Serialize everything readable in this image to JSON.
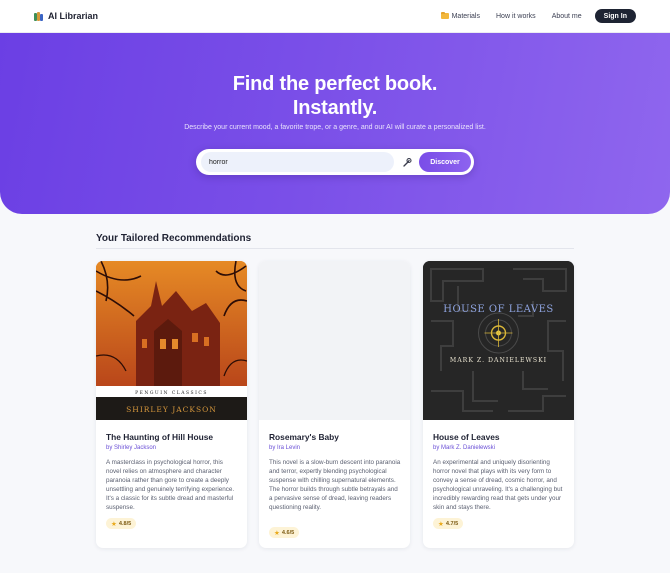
{
  "nav": {
    "brand": "AI Librarian",
    "links": [
      "Materials",
      "How it works",
      "About me"
    ],
    "signin": "Sign In"
  },
  "hero": {
    "title_line1": "Find the perfect book.",
    "title_line2": "Instantly.",
    "subtitle": "Describe your current mood, a favorite trope, or a genre, and our AI will curate a personalized list.",
    "search_value": "horror",
    "discover": "Discover"
  },
  "section": {
    "title": "Your Tailored Recommendations"
  },
  "books": [
    {
      "title": "The Haunting of Hill House",
      "author": "by Shirley Jackson",
      "description": "A masterclass in psychological horror, this novel relies on atmosphere and character paranoia rather than gore to create a deeply unsettling and genuinely terrifying experience. It's a classic for its subtle dread and masterful suspense.",
      "rating": "4.8/5",
      "cover_publisher": "PENGUIN   CLASSICS",
      "cover_author": "SHIRLEY JACKSON"
    },
    {
      "title": "Rosemary's Baby",
      "author": "by Ira Levin",
      "description": "This novel is a slow-burn descent into paranoia and terror, expertly blending psychological suspense with chilling supernatural elements. The horror builds through subtle betrayals and a pervasive sense of dread, leaving readers questioning reality.",
      "rating": "4.6/5"
    },
    {
      "title": "House of Leaves",
      "author": "by Mark Z. Danielewski",
      "description": "An experimental and uniquely disorienting horror novel that plays with its very form to convey a sense of dread, cosmic horror, and psychological unraveling. It's a challenging but incredibly rewarding read that gets under your skin and stays there.",
      "rating": "4.7/5",
      "cover_title": "HOUSE OF LEAVES",
      "cover_author": "MARK Z. DANIELEWSKI"
    }
  ]
}
